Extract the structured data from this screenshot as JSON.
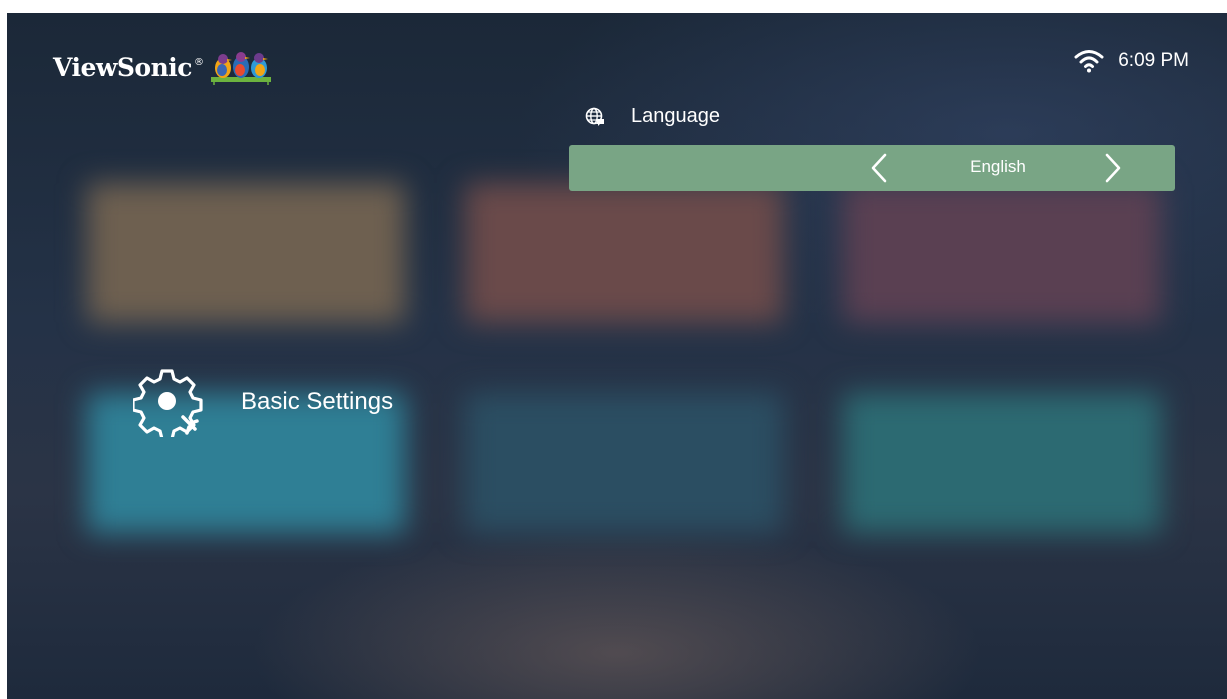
{
  "header": {
    "brand": "ViewSonic",
    "brand_mark": "®",
    "logo_icon": "three-birds-logo-icon",
    "wifi_icon": "wifi-icon",
    "time": "6:09 PM"
  },
  "setting": {
    "icon": "globe-icon",
    "label": "Language",
    "value": "English",
    "prev_icon": "chevron-left-icon",
    "next_icon": "chevron-right-icon"
  },
  "category": {
    "icon": "gear-icon",
    "label": "Basic Settings"
  },
  "colors": {
    "selector_bg": "#79a585",
    "text": "#ffffff",
    "wifi": "#ffffff"
  }
}
